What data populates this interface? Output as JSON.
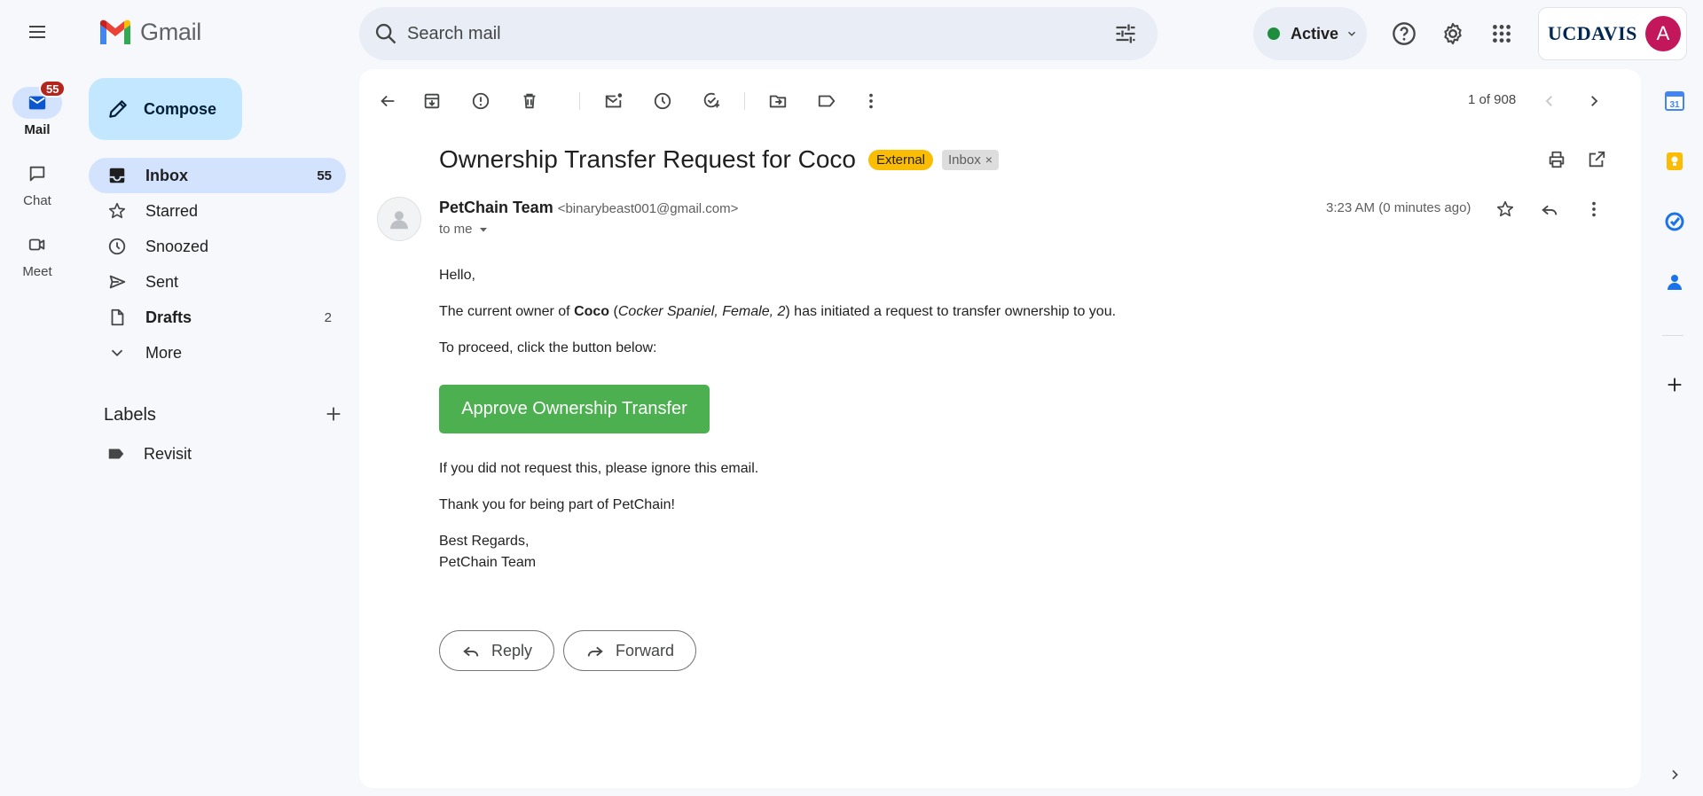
{
  "app": {
    "name": "Gmail"
  },
  "search": {
    "placeholder": "Search mail"
  },
  "status": {
    "label": "Active",
    "color": "#1e8e3e"
  },
  "account": {
    "org_logo_text": "UCDAVIS",
    "avatar_initial": "A",
    "avatar_color": "#c2185b"
  },
  "rail": {
    "items": [
      {
        "label": "Mail",
        "icon": "mail-icon",
        "badge": "55"
      },
      {
        "label": "Chat",
        "icon": "chat-icon"
      },
      {
        "label": "Meet",
        "icon": "meet-icon"
      }
    ]
  },
  "sidebar": {
    "compose_label": "Compose",
    "items": [
      {
        "label": "Inbox",
        "count": "55",
        "icon": "inbox-icon"
      },
      {
        "label": "Starred",
        "count": "",
        "icon": "star-icon"
      },
      {
        "label": "Snoozed",
        "count": "",
        "icon": "clock-icon"
      },
      {
        "label": "Sent",
        "count": "",
        "icon": "send-icon"
      },
      {
        "label": "Drafts",
        "count": "2",
        "icon": "draft-icon"
      },
      {
        "label": "More",
        "count": "",
        "icon": "chevron-down-icon"
      }
    ],
    "labels_title": "Labels",
    "labels": [
      {
        "label": "Revisit",
        "icon": "label-icon"
      }
    ]
  },
  "toolbar": {
    "pager": "1 of 908"
  },
  "email": {
    "subject": "Ownership Transfer Request for Coco",
    "tags": {
      "external": "External",
      "inbox": "Inbox",
      "remove": "×"
    },
    "sender_name": "PetChain Team",
    "sender_email": "<binarybeast001@gmail.com>",
    "recipient": "to me",
    "timestamp": "3:23 AM (0 minutes ago)",
    "greeting": "Hello,",
    "line1": {
      "pre": "The current owner of ",
      "pet": "Coco",
      "paren_open": " (",
      "details": "Cocker Spaniel, Female, 2",
      "post": ") has initiated a request to transfer ownership to you."
    },
    "line2": "To proceed, click the button below:",
    "button_label": "Approve Ownership Transfer",
    "button_color": "#4caf50",
    "line3": "If you did not request this, please ignore this email.",
    "line4": "Thank you for being part of PetChain!",
    "signoff": "Best Regards,",
    "signature": "PetChain Team"
  },
  "actions": {
    "reply": "Reply",
    "forward": "Forward"
  },
  "side_panel": {
    "calendar_date": "31",
    "apps": [
      "calendar-icon",
      "keep-icon",
      "tasks-icon",
      "contacts-icon",
      "add-icon"
    ]
  }
}
